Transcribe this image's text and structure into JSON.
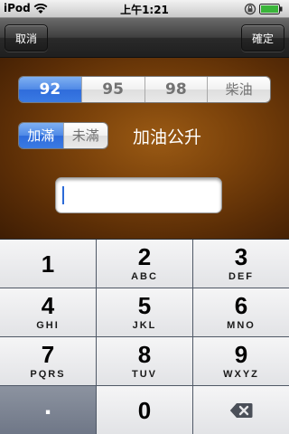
{
  "status_bar": {
    "carrier": "iPod",
    "time": "上午1:21"
  },
  "nav": {
    "cancel_label": "取消",
    "confirm_label": "確定"
  },
  "fuel_types": {
    "options": [
      "92",
      "95",
      "98",
      "柴油"
    ],
    "selected": "92"
  },
  "fill_mode": {
    "options": [
      "加滿",
      "未滿"
    ],
    "selected": "加滿"
  },
  "unit_label": "加油公升",
  "amount_input": {
    "value": "",
    "placeholder": ""
  },
  "keypad": {
    "keys": [
      {
        "num": "1",
        "letters": ""
      },
      {
        "num": "2",
        "letters": "ABC"
      },
      {
        "num": "3",
        "letters": "DEF"
      },
      {
        "num": "4",
        "letters": "GHI"
      },
      {
        "num": "5",
        "letters": "JKL"
      },
      {
        "num": "6",
        "letters": "MNO"
      },
      {
        "num": "7",
        "letters": "PQRS"
      },
      {
        "num": "8",
        "letters": "TUV"
      },
      {
        "num": "9",
        "letters": "WXYZ"
      },
      {
        "num": ".",
        "letters": ""
      },
      {
        "num": "0",
        "letters": ""
      }
    ],
    "delete_icon": "backspace-icon"
  }
}
